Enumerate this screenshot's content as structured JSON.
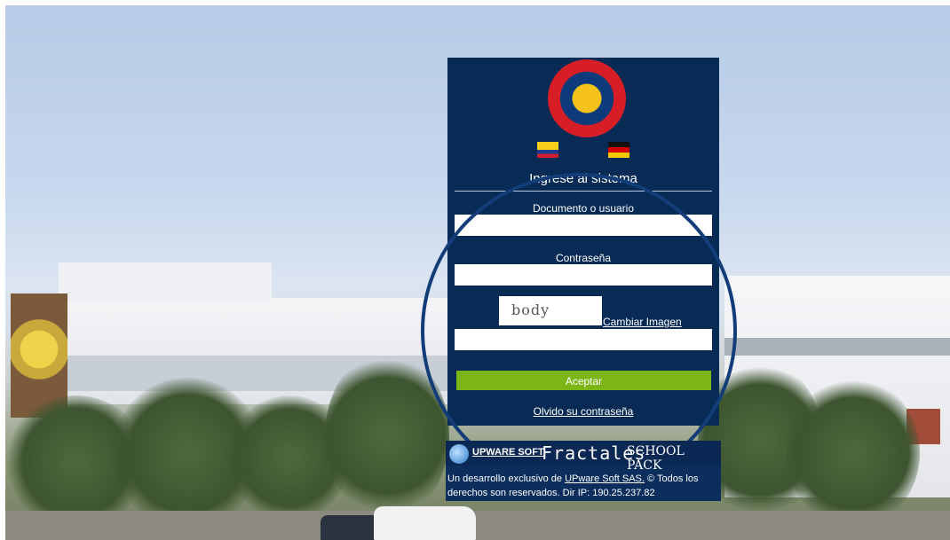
{
  "login": {
    "title": "Ingrese al sistema",
    "user_label": "Documento o usuario",
    "user_value": "",
    "password_label": "Contraseña",
    "password_value": "",
    "captcha_text": "body",
    "change_image_link": "Cambiar Imagen",
    "captcha_value": "",
    "submit_label": "Aceptar",
    "forgot_link": "Olvido su contraseña"
  },
  "languages": [
    "colombia-flag",
    "germany-flag"
  ],
  "footer": {
    "upware_logo_text": "UPWARE SOFT",
    "fractales_text": "Fractales",
    "schoolpack_text": "SCHOOL PACK",
    "copyright_prefix": "Un desarrollo exclusivo de",
    "company_link": "UPware Soft SAS.",
    "copyright_suffix": "© Todos los derechos son reservados. Dir IP:",
    "ip": "190.25.237.82"
  },
  "colors": {
    "panel_bg": "#082b56",
    "accent_green": "#7cb518",
    "highlight_circle": "#123d78"
  }
}
